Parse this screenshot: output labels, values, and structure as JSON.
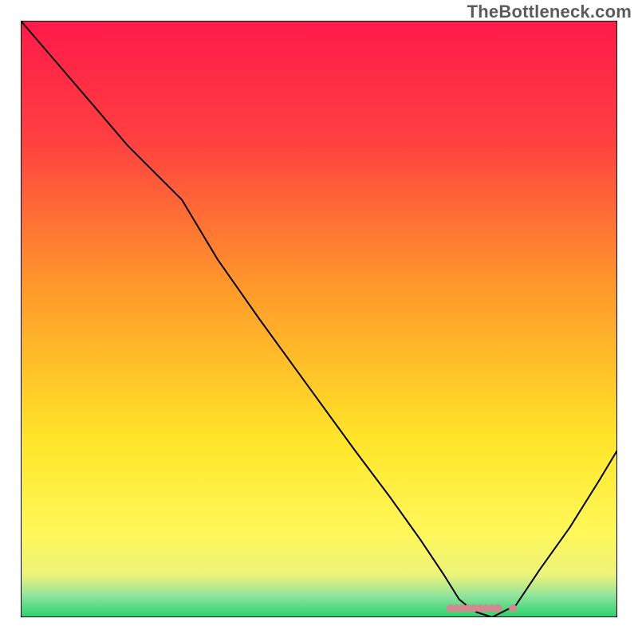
{
  "watermark": "TheBottleneck.com",
  "chart_data": {
    "type": "line",
    "title": "",
    "xlabel": "",
    "ylabel": "",
    "xlim": [
      0,
      100
    ],
    "ylim": [
      0,
      100
    ],
    "grid": false,
    "background_gradient": {
      "direction": "vertical",
      "stops": [
        {
          "offset": 0.0,
          "color": "#ff1a4b"
        },
        {
          "offset": 0.2,
          "color": "#ff4040"
        },
        {
          "offset": 0.45,
          "color": "#ff9a2a"
        },
        {
          "offset": 0.7,
          "color": "#ffe528"
        },
        {
          "offset": 0.86,
          "color": "#fff85a"
        },
        {
          "offset": 0.93,
          "color": "#ecf37a"
        },
        {
          "offset": 0.965,
          "color": "#8de39c"
        },
        {
          "offset": 1.0,
          "color": "#26d36e"
        }
      ]
    },
    "series": [
      {
        "name": "bottleneck-curve",
        "type": "line",
        "color": "#000000",
        "width": 2,
        "x": [
          0,
          6,
          12,
          18,
          23,
          27,
          33,
          40,
          48,
          56,
          62,
          67,
          71,
          73.5,
          76,
          79,
          83,
          87,
          92,
          97,
          100
        ],
        "y": [
          100,
          93,
          86,
          79,
          74,
          70,
          60,
          50,
          39,
          28,
          20,
          13,
          7,
          3,
          1,
          0,
          2,
          8,
          15,
          23,
          28
        ]
      },
      {
        "name": "optimal-marker",
        "type": "scatter",
        "color": "#d1888f",
        "size": 10,
        "x": [
          72,
          73,
          74,
          75,
          76,
          77,
          78,
          79,
          80,
          82.5
        ],
        "y": [
          1.5,
          1.5,
          1.5,
          1.5,
          1.5,
          1.5,
          1.5,
          1.5,
          1.5,
          1.5
        ]
      }
    ]
  }
}
